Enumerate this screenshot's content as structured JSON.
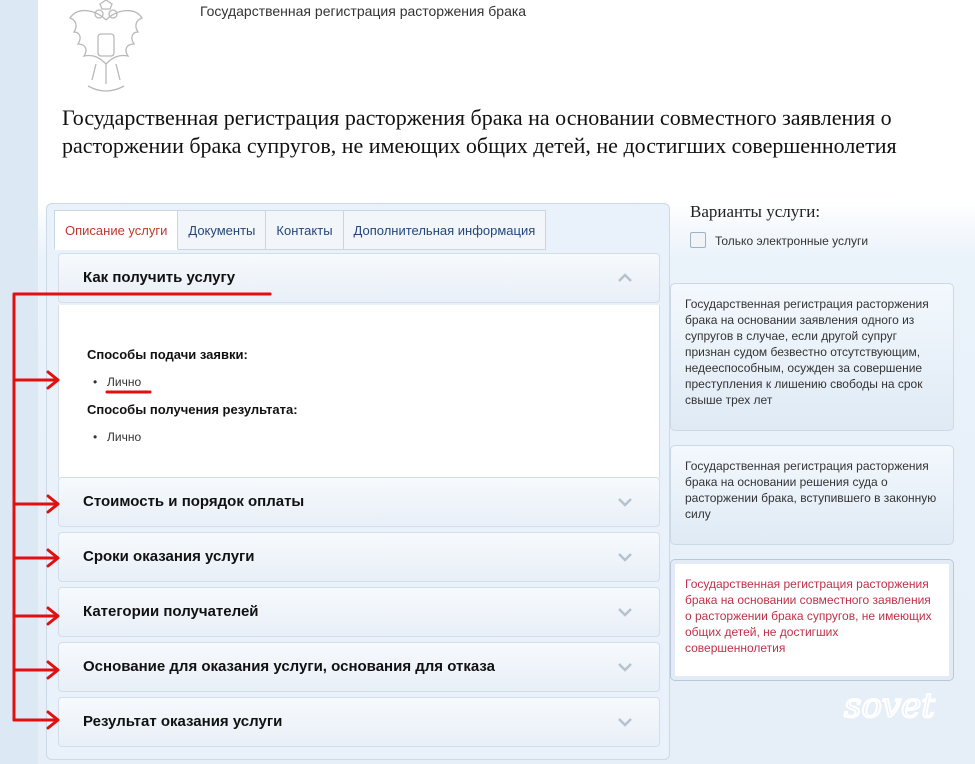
{
  "header": {
    "top_title": "Государственная регистрация расторжения брака",
    "main_heading": "Государственная регистрация расторжения брака на основании совместного заявления о расторжении брака супругов, не имеющих общих детей, не достигших совершеннолетия"
  },
  "tabs": [
    {
      "label": "Описание услуги",
      "active": true
    },
    {
      "label": "Документы"
    },
    {
      "label": "Контакты"
    },
    {
      "label": "Дополнительная информация"
    }
  ],
  "accordion": {
    "open_item": {
      "title": "Как получить услугу",
      "submit_heading": "Способы подачи заявки:",
      "submit_item": "Лично",
      "result_heading": "Способы получения результата:",
      "result_item": "Лично"
    },
    "items": [
      "Стоимость и порядок оплаты",
      "Сроки оказания услуги",
      "Категории получателей",
      "Основание для оказания услуги, основания для отказа",
      "Результат оказания услуги"
    ]
  },
  "variants": {
    "title": "Варианты услуги:",
    "checkbox_label": "Только электронные услуги",
    "cards": [
      "Государственная регистрация расторжения брака на основании заявления одного из супругов в случае, если другой супруг признан судом безвестно отсутствующим, недееспособным, осужден за совершение преступления к лишению свободы на срок свыше трех лет",
      "Государственная регистрация расторжения брака на основании решения суда о расторжении брака, вступившего в законную силу",
      "Государственная регистрация расторжения брака на основании совместного заявления о расторжении брака супругов, не имеющих общих детей, не достигших совершеннолетия"
    ]
  },
  "watermark": "sovet",
  "colors": {
    "annotation_red": "#e01010",
    "active_tab_text": "#c0392b",
    "active_variant_text": "#c0304a"
  }
}
